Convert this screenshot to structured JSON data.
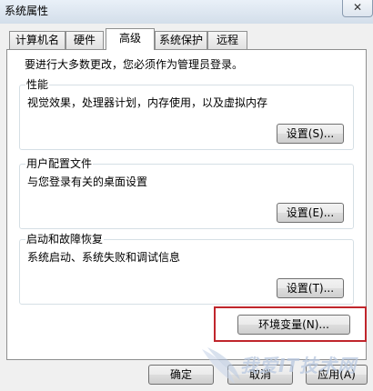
{
  "window": {
    "title": "系统属性",
    "close_glyph": "✕"
  },
  "tabs": [
    {
      "label": "计算机名",
      "active": false
    },
    {
      "label": "硬件",
      "active": false
    },
    {
      "label": "高级",
      "active": true
    },
    {
      "label": "系统保护",
      "active": false
    },
    {
      "label": "远程",
      "active": false
    }
  ],
  "advanced": {
    "intro": "要进行大多数更改，您必须作为管理员登录。",
    "performance": {
      "title": "性能",
      "description": "视觉效果，处理器计划，内存使用，以及虚拟内存",
      "button": "设置(S)..."
    },
    "user_profiles": {
      "title": "用户配置文件",
      "description": "与您登录有关的桌面设置",
      "button": "设置(E)..."
    },
    "startup_recovery": {
      "title": "启动和故障恢复",
      "description": "系统启动、系统失败和调试信息",
      "button": "设置(T)..."
    },
    "env_button": "环境变量(N)..."
  },
  "footer": {
    "ok": "确定",
    "cancel": "取消",
    "apply": "应用(A)"
  },
  "watermark": {
    "text": "我爱IT技术网"
  },
  "colors": {
    "highlight": "#c0262c",
    "title_bar": "#dfe8f1"
  }
}
